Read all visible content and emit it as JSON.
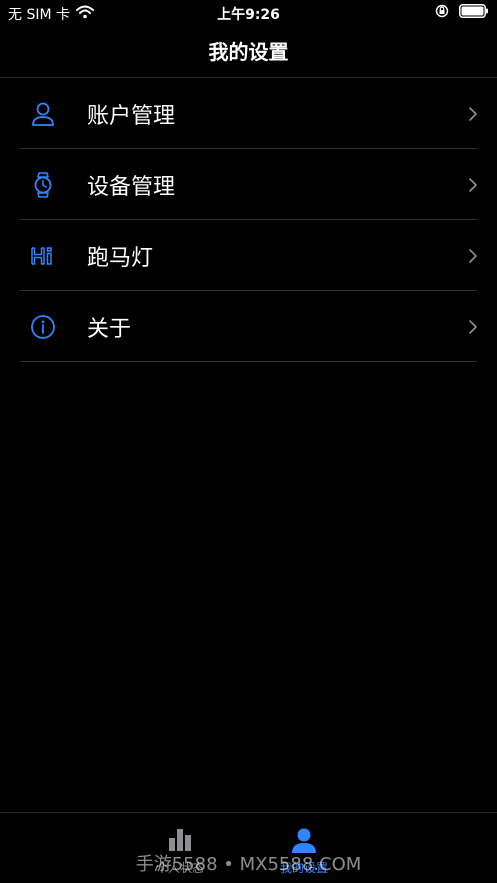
{
  "status_bar": {
    "carrier": "无 SIM 卡",
    "time": "上午9:26",
    "wifi_icon": "wifi-icon",
    "orientation_lock_icon": "orientation-lock-icon",
    "battery_icon": "battery-icon"
  },
  "header": {
    "title": "我的设置"
  },
  "menu": {
    "items": [
      {
        "label": "账户管理",
        "icon": "user-icon"
      },
      {
        "label": "设备管理",
        "icon": "watch-icon"
      },
      {
        "label": "跑马灯",
        "icon": "hi-marquee-icon"
      },
      {
        "label": "关于",
        "icon": "info-icon"
      }
    ]
  },
  "tab_bar": {
    "tabs": [
      {
        "label": "个人状态",
        "icon": "bar-chart-icon",
        "active": false
      },
      {
        "label": "我的设置",
        "icon": "person-icon",
        "active": true
      }
    ]
  },
  "watermark": "手游5588 • MX5588.COM",
  "colors": {
    "accent": "#2f86ff",
    "background": "#000000",
    "divider": "#333333",
    "inactive_tab": "#8e8e93"
  }
}
